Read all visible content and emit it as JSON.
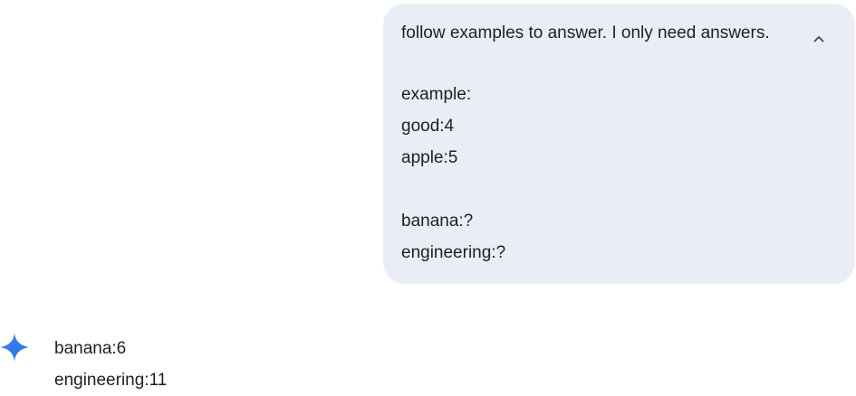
{
  "user_message": {
    "lines": [
      "follow examples to answer. I only need answers.",
      "",
      "example:",
      "good:4",
      "apple:5",
      "",
      "banana:?",
      "engineering:?"
    ],
    "collapse_icon": "chevron-up-icon"
  },
  "model_response": {
    "icon": "gemini-sparkle-icon",
    "lines": [
      "banana:6",
      "engineering:11"
    ]
  },
  "colors": {
    "bubble_background": "#e9eef6",
    "text": "#1f1f1f",
    "sparkle_start": "#4f7df3",
    "sparkle_end": "#1a73e8"
  }
}
